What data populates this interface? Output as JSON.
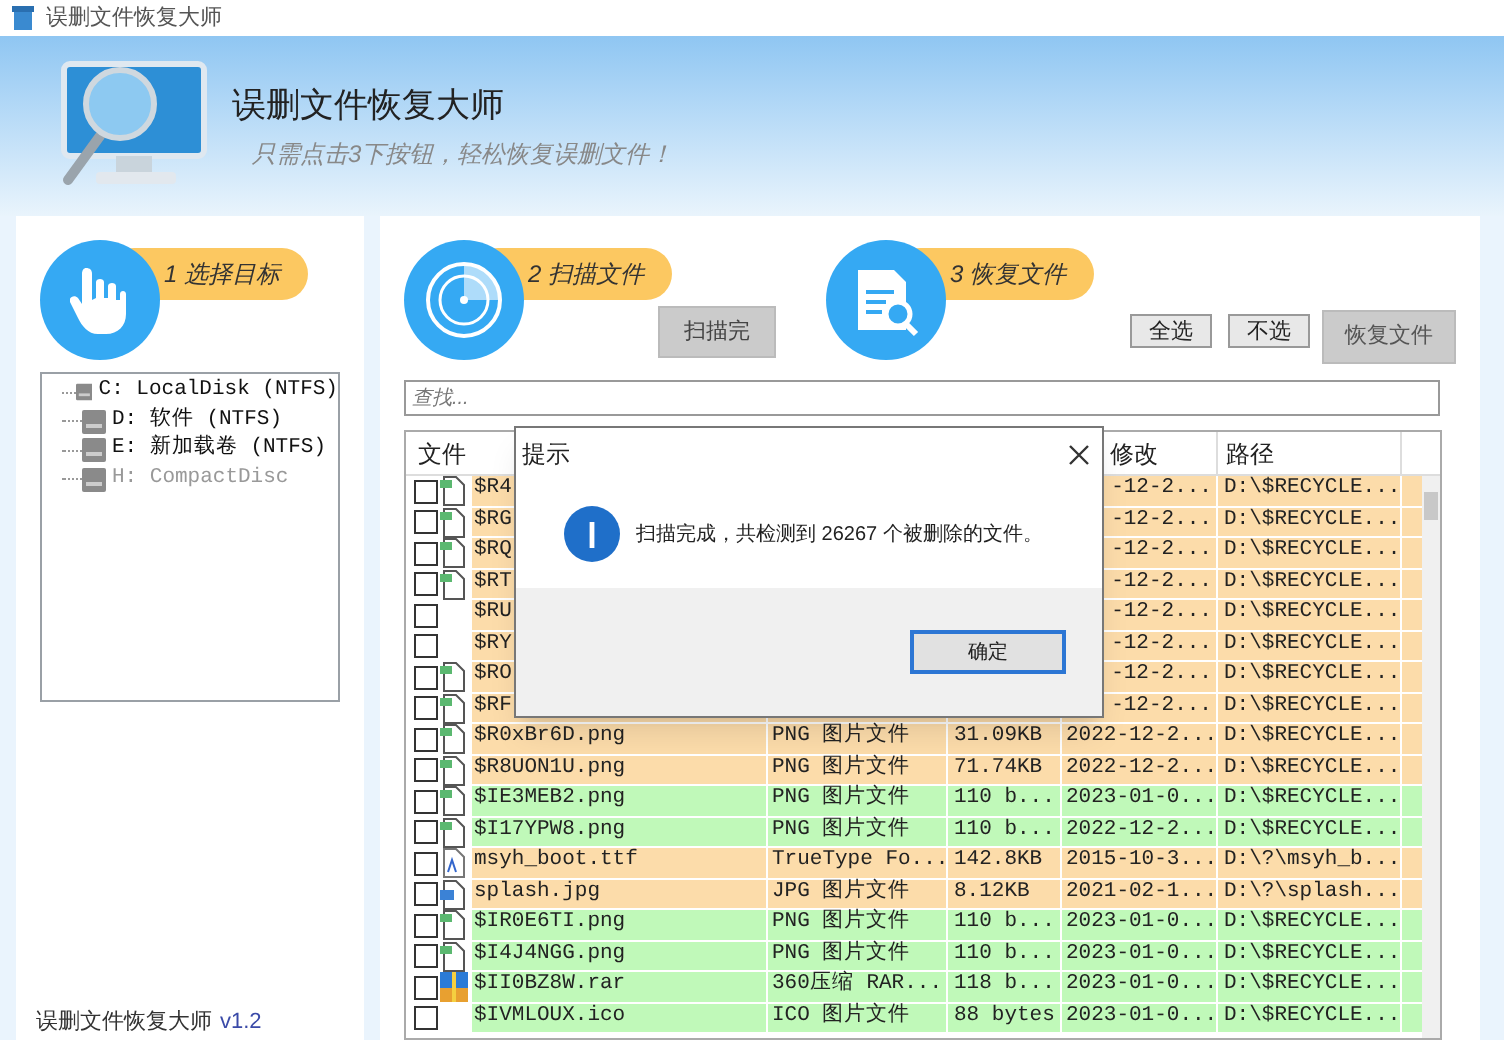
{
  "window": {
    "title": "误删文件恢复大师"
  },
  "header": {
    "title": "误删文件恢复大师",
    "subtitle": "只需点击3下按钮，轻松恢复误删文件！"
  },
  "steps": [
    {
      "label": "1 选择目标"
    },
    {
      "label": "2 扫描文件"
    },
    {
      "label": "3 恢复文件"
    }
  ],
  "drives": [
    {
      "label": "C: LocalDisk (NTFS)",
      "disabled": false
    },
    {
      "label": "D: 软件 (NTFS)",
      "disabled": false
    },
    {
      "label": "E: 新加载卷 (NTFS)",
      "disabled": false
    },
    {
      "label": "H: CompactDisc",
      "disabled": true
    }
  ],
  "version": {
    "name": "误删文件恢复大师",
    "number": "v1.2"
  },
  "buttons": {
    "scan": "扫描完",
    "select_all": "全选",
    "select_none": "不选",
    "recover": "恢复文件"
  },
  "search": {
    "placeholder": "查找..."
  },
  "table": {
    "columns": [
      "文件",
      "修改",
      "路径"
    ],
    "rows": [
      {
        "kind": "image",
        "checked": false,
        "name": "$R4",
        "modified": "-12-2...",
        "path": "D:\\$RECYCLE...",
        "color": "#fcdcaa"
      },
      {
        "kind": "image",
        "checked": false,
        "name": "$RG",
        "modified": "-12-2...",
        "path": "D:\\$RECYCLE...",
        "color": "#fcdcaa"
      },
      {
        "kind": "image",
        "checked": false,
        "name": "$RQ",
        "modified": "-12-2...",
        "path": "D:\\$RECYCLE...",
        "color": "#fcdcaa"
      },
      {
        "kind": "image",
        "checked": false,
        "name": "$RT",
        "modified": "-12-2...",
        "path": "D:\\$RECYCLE...",
        "color": "#fcdcaa"
      },
      {
        "kind": "none",
        "checked": false,
        "name": "$RU",
        "modified": "-12-2...",
        "path": "D:\\$RECYCLE...",
        "color": "#fcdcaa"
      },
      {
        "kind": "none",
        "checked": false,
        "name": "$RY",
        "modified": "-12-2...",
        "path": "D:\\$RECYCLE...",
        "color": "#fcdcaa"
      },
      {
        "kind": "image",
        "checked": false,
        "name": "$RO",
        "modified": "-12-2...",
        "path": "D:\\$RECYCLE...",
        "color": "#fcdcaa"
      },
      {
        "kind": "image",
        "checked": false,
        "name": "$RF",
        "modified": "-12-2...",
        "path": "D:\\$RECYCLE...",
        "color": "#fcdcaa"
      },
      {
        "kind": "image",
        "checked": false,
        "name": "$R0xBr6D.png",
        "type": "PNG 图片文件",
        "size": "31.09KB",
        "modified": "2022-12-2...",
        "path": "D:\\$RECYCLE...",
        "color": "#fcdcaa"
      },
      {
        "kind": "image",
        "checked": false,
        "name": "$R8UON1U.png",
        "type": "PNG 图片文件",
        "size": "71.74KB",
        "modified": "2022-12-2...",
        "path": "D:\\$RECYCLE...",
        "color": "#fcdcaa"
      },
      {
        "kind": "image",
        "checked": false,
        "name": "$IE3MEB2.png",
        "type": "PNG 图片文件",
        "size": "110 b...",
        "modified": "2023-01-0...",
        "path": "D:\\$RECYCLE...",
        "color": "#c0f9b9"
      },
      {
        "kind": "image",
        "checked": false,
        "name": "$I17YPW8.png",
        "type": "PNG 图片文件",
        "size": "110 b...",
        "modified": "2022-12-2...",
        "path": "D:\\$RECYCLE...",
        "color": "#c0f9b9"
      },
      {
        "kind": "font",
        "checked": false,
        "name": "msyh_boot.ttf",
        "type": "TrueType Fo...",
        "size": "142.8KB",
        "modified": "2015-10-3...",
        "path": "D:\\?\\msyh_b...",
        "color": "#fcdcaa"
      },
      {
        "kind": "photo",
        "checked": false,
        "name": "splash.jpg",
        "type": "JPG 图片文件",
        "size": "8.12KB",
        "modified": "2021-02-1...",
        "path": "D:\\?\\splash...",
        "color": "#fcdcaa"
      },
      {
        "kind": "image",
        "checked": false,
        "name": "$IR0E6TI.png",
        "type": "PNG 图片文件",
        "size": "110 b...",
        "modified": "2023-01-0...",
        "path": "D:\\$RECYCLE...",
        "color": "#c0f9b9"
      },
      {
        "kind": "image",
        "checked": false,
        "name": "$I4J4NGG.png",
        "type": "PNG 图片文件",
        "size": "110 b...",
        "modified": "2023-01-0...",
        "path": "D:\\$RECYCLE...",
        "color": "#c0f9b9"
      },
      {
        "kind": "archive",
        "checked": false,
        "name": "$II0BZ8W.rar",
        "type": "360压缩 RAR...",
        "size": "118 b...",
        "modified": "2023-01-0...",
        "path": "D:\\$RECYCLE...",
        "color": "#c0f9b9"
      },
      {
        "kind": "none",
        "checked": false,
        "name": "$IVMLOUX.ico",
        "type": "ICO 图片文件",
        "size": "88 bytes",
        "modified": "2023-01-0...",
        "path": "D:\\$RECYCLE...",
        "color": "#c0f9b9"
      }
    ]
  },
  "dialog": {
    "title": "提示",
    "message": "扫描完成，共检测到 26267 个被删除的文件。",
    "button": "确定"
  }
}
